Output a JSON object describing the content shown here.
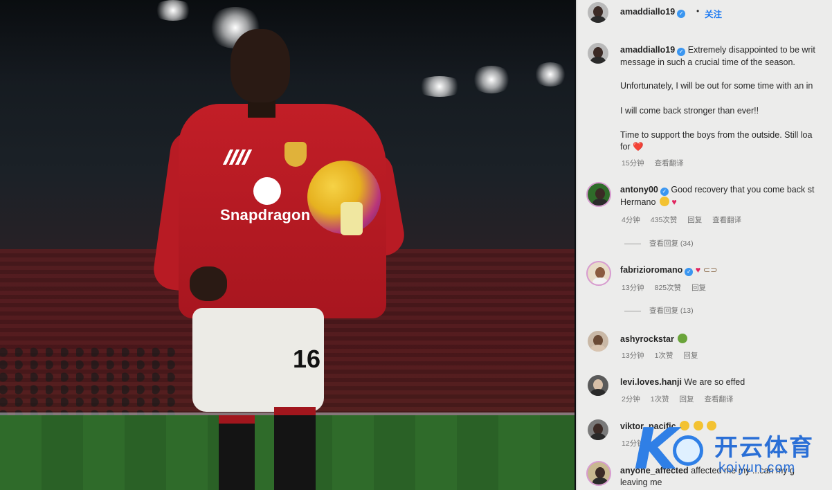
{
  "post": {
    "author": "amaddiallo19",
    "follow_label": "关注",
    "caption_lines": [
      "amaddiallo19",
      "Extremely disappointed to be writ",
      "message in such a crucial time of the season.",
      "Unfortunately, I will be out for some time with an in",
      "I will come back stronger than ever!!",
      "Time to support the boys from the outside. Still loa",
      "for ❤️"
    ],
    "caption_meta": [
      "15分钟",
      "查看翻译"
    ]
  },
  "photo": {
    "sponsor_text": "Snapdragon",
    "shorts_number": "16"
  },
  "comments": [
    {
      "username": "antony00",
      "verified": true,
      "text_line1": "Good recovery that you come back st",
      "text_line2": "Hermano",
      "meta": [
        "4分钟",
        "435次赞",
        "回复",
        "查看翻译"
      ],
      "replies_label": "查看回复 (34)"
    },
    {
      "username": "fabrizioromano",
      "verified": true,
      "text_line1": "",
      "meta": [
        "13分钟",
        "825次赞",
        "回复"
      ],
      "replies_label": "查看回复 (13)"
    },
    {
      "username": "ashyrockstar",
      "verified": false,
      "text_line1": "",
      "meta": [
        "13分钟",
        "1次赞",
        "回复"
      ]
    },
    {
      "username": "levi.loves.hanji",
      "verified": false,
      "text_line1": "We are so effed",
      "meta": [
        "2分钟",
        "1次赞",
        "回复",
        "查看翻译"
      ]
    },
    {
      "username": "viktor_pacific",
      "verified": false,
      "text_line1": "",
      "meta": [
        "12分钟"
      ]
    },
    {
      "username": "anyone_affected",
      "verified": false,
      "text_line1": "affected me my ...can my g",
      "text_line2": "leaving me"
    }
  ],
  "watermark": {
    "cn": "开云体育",
    "en": "koiyun.com"
  },
  "colors": {
    "link_blue": "#1877f2",
    "verified_blue": "#3b96f0",
    "heart_red": "#e0245e",
    "jersey_red": "#c21e27"
  }
}
